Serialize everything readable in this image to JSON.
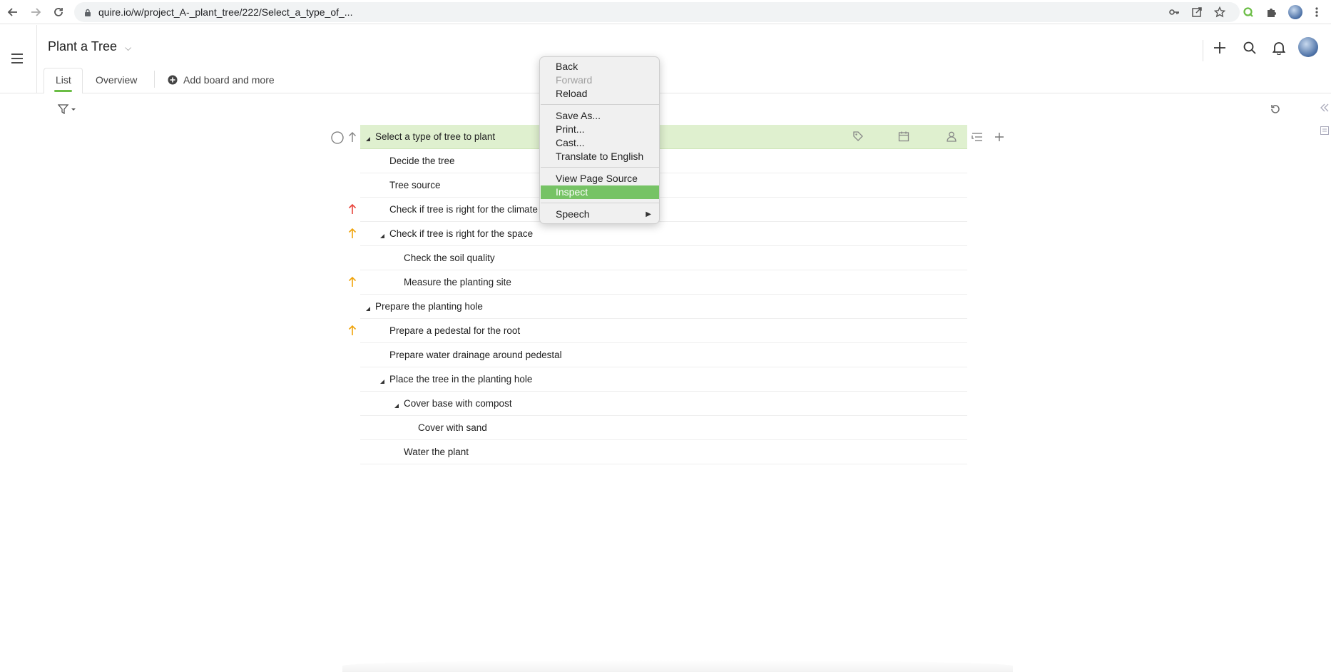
{
  "browser": {
    "url": "quire.io/w/project_A-_plant_tree/222/Select_a_type_of_..."
  },
  "header": {
    "project_title": "Plant a Tree",
    "tabs": [
      {
        "label": "List",
        "active": true
      },
      {
        "label": "Overview",
        "active": false
      },
      {
        "label": "Add board and more",
        "active": false
      }
    ]
  },
  "tasks": [
    {
      "title": "Select a type of tree to plant",
      "level": 0,
      "expanded": true,
      "priority": "none",
      "selected": true
    },
    {
      "title": "Decide the tree",
      "level": 1,
      "expanded": null,
      "priority": "none"
    },
    {
      "title": "Tree source",
      "level": 1,
      "expanded": null,
      "priority": "none"
    },
    {
      "title": "Check if tree is right for the climate",
      "level": 1,
      "expanded": null,
      "priority": "urgent"
    },
    {
      "title": "Check if tree is right for the space",
      "level": 1,
      "expanded": true,
      "priority": "high"
    },
    {
      "title": "Check the soil quality",
      "level": 2,
      "expanded": null,
      "priority": "none"
    },
    {
      "title": "Measure the planting site",
      "level": 2,
      "expanded": null,
      "priority": "high"
    },
    {
      "title": "Prepare the planting hole",
      "level": 0,
      "expanded": true,
      "priority": "none"
    },
    {
      "title": "Prepare a pedestal for the root",
      "level": 1,
      "expanded": null,
      "priority": "high"
    },
    {
      "title": "Prepare water drainage around pedestal",
      "level": 1,
      "expanded": null,
      "priority": "none"
    },
    {
      "title": "Place the tree in the planting hole",
      "level": 1,
      "expanded": true,
      "priority": "none"
    },
    {
      "title": "Cover base with compost",
      "level": 2,
      "expanded": true,
      "priority": "none"
    },
    {
      "title": "Cover with sand",
      "level": 3,
      "expanded": null,
      "priority": "none"
    },
    {
      "title": "Water the plant",
      "level": 2,
      "expanded": null,
      "priority": "none"
    }
  ],
  "context_menu": {
    "groups": [
      [
        {
          "label": "Back",
          "enabled": true
        },
        {
          "label": "Forward",
          "enabled": false
        },
        {
          "label": "Reload",
          "enabled": true
        }
      ],
      [
        {
          "label": "Save As...",
          "enabled": true
        },
        {
          "label": "Print...",
          "enabled": true
        },
        {
          "label": "Cast...",
          "enabled": true
        },
        {
          "label": "Translate to English",
          "enabled": true
        }
      ],
      [
        {
          "label": "View Page Source",
          "enabled": true
        },
        {
          "label": "Inspect",
          "enabled": true,
          "highlighted": true
        }
      ],
      [
        {
          "label": "Speech",
          "enabled": true,
          "submenu": true
        }
      ]
    ]
  },
  "colors": {
    "accent_green": "#6bbd45",
    "selected_row": "#dff0cf",
    "menu_highlight": "#76c365",
    "priority_urgent": "#e8453c",
    "priority_high": "#f0a30a"
  },
  "icons": {
    "submenu_arrow": "▶"
  }
}
